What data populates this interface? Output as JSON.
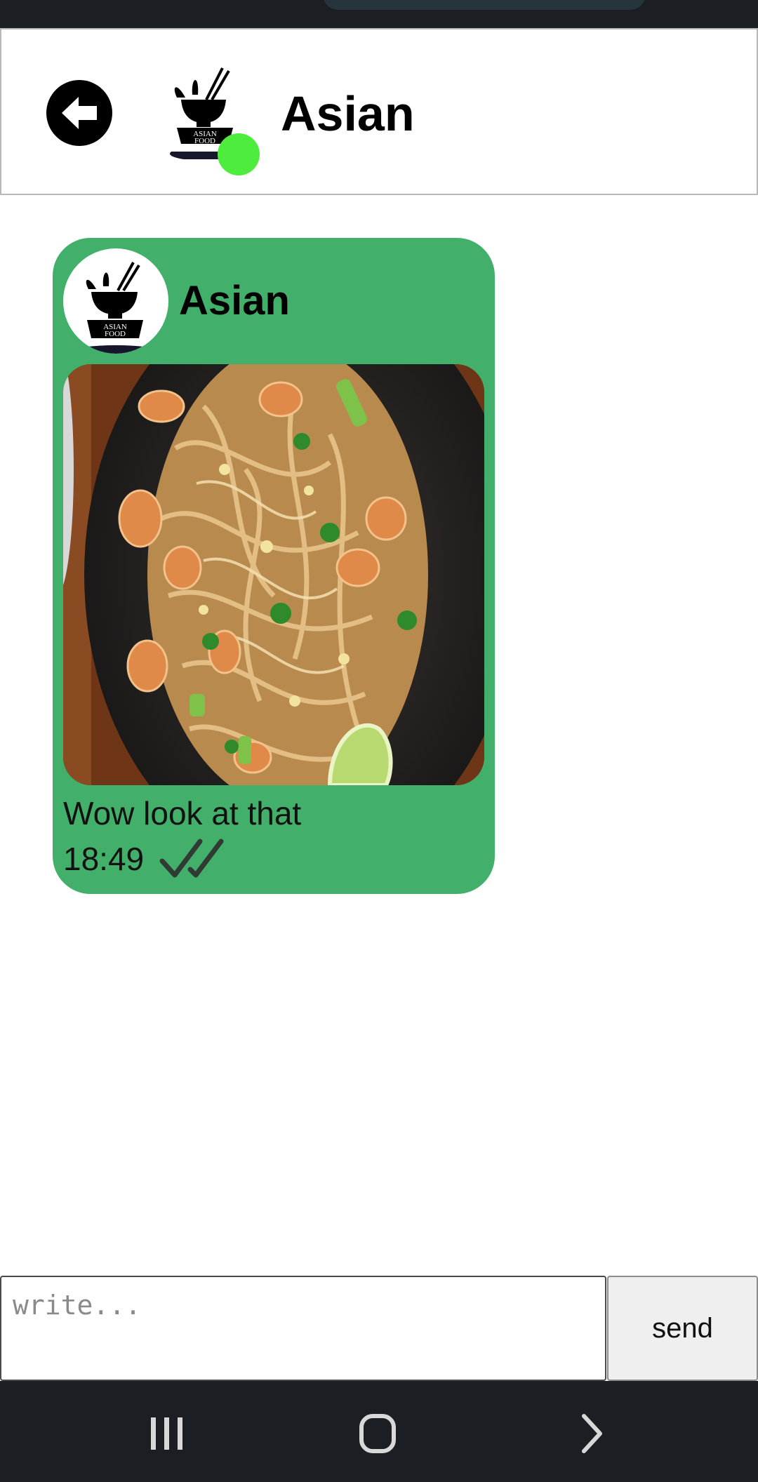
{
  "header": {
    "title": "Asian",
    "back_icon": "back-arrow-icon",
    "avatar": "asian-food-logo",
    "online_color": "#4dec3d"
  },
  "logo": {
    "line1": "ASIAN",
    "line2": "FOOD"
  },
  "message": {
    "sender": "Asian",
    "image": "pad-thai-noodles-photo",
    "text": "Wow look at that",
    "time": "18:49",
    "status_icon": "double-check-icon",
    "bubble_color": "#42b06a"
  },
  "compose": {
    "placeholder": "write...",
    "send_label": "send"
  },
  "nav": {
    "recents_icon": "recents-icon",
    "home_icon": "home-icon",
    "back_icon": "forward-chevron-icon"
  }
}
